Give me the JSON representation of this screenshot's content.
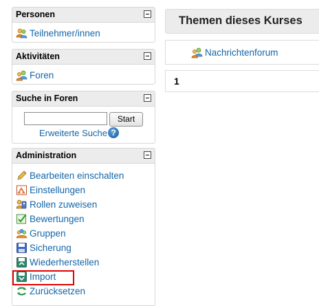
{
  "blocks": {
    "personen": {
      "title": "Personen",
      "items": [
        {
          "label": "Teilnehmer/innen",
          "icon": "users-icon"
        }
      ]
    },
    "aktivitaeten": {
      "title": "Aktivitäten",
      "items": [
        {
          "label": "Foren",
          "icon": "forum-icon"
        }
      ]
    },
    "suche": {
      "title": "Suche in Foren",
      "button_label": "Start",
      "input_value": "",
      "advanced_link": "Erweiterte Suche",
      "help_icon": "help-icon"
    },
    "administration": {
      "title": "Administration",
      "items": [
        {
          "label": "Bearbeiten einschalten",
          "icon": "pencil-icon"
        },
        {
          "label": "Einstellungen",
          "icon": "settings-icon"
        },
        {
          "label": "Rollen zuweisen",
          "icon": "roles-icon"
        },
        {
          "label": "Bewertungen",
          "icon": "grades-icon"
        },
        {
          "label": "Gruppen",
          "icon": "groups-icon"
        },
        {
          "label": "Sicherung",
          "icon": "backup-icon"
        },
        {
          "label": "Wiederherstellen",
          "icon": "restore-icon"
        },
        {
          "label": "Import",
          "icon": "import-icon"
        },
        {
          "label": "Zurücksetzen",
          "icon": "reset-icon"
        }
      ]
    }
  },
  "course": {
    "title": "Themen dieses Kurses",
    "forum_link": "Nachrichtenforum",
    "section_number": "1"
  },
  "colors": {
    "link": "#1466a8",
    "header_bg": "#ececec",
    "highlight": "#e00000"
  }
}
